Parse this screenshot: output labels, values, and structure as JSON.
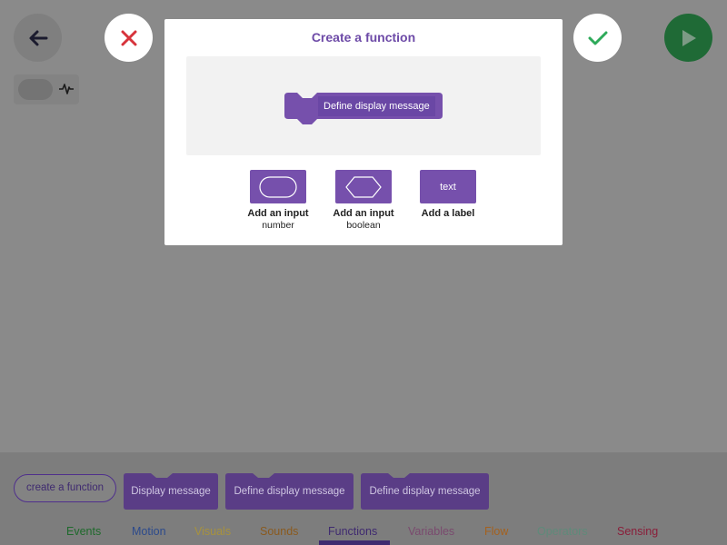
{
  "modal": {
    "title": "Create a function",
    "preview_block_label": "Define display message",
    "options": [
      {
        "title": "Add an input",
        "subtitle": "number"
      },
      {
        "title": "Add an input",
        "subtitle": "boolean"
      },
      {
        "title": "Add a label",
        "subtitle": "",
        "tile_text": "text"
      }
    ]
  },
  "toolbar": {
    "back_icon": "arrow-left-icon",
    "cancel_icon": "close-icon",
    "confirm_icon": "check-icon",
    "play_icon": "play-icon",
    "pulse_icon": "pulse-icon"
  },
  "palette": {
    "create_button_label": "create a function",
    "blocks": [
      {
        "label": "Display message"
      },
      {
        "label": "Define display message"
      },
      {
        "label": "Define display message"
      }
    ]
  },
  "tabs": [
    {
      "label": "Events",
      "color": "#1f6a2c"
    },
    {
      "label": "Motion",
      "color": "#2c4a8c"
    },
    {
      "label": "Visuals",
      "color": "#a7923e"
    },
    {
      "label": "Sounds",
      "color": "#8a5a1e"
    },
    {
      "label": "Functions",
      "color": "#3f2a70",
      "selected": true
    },
    {
      "label": "Variables",
      "color": "#7a4a6e"
    },
    {
      "label": "Flow",
      "color": "#a4611e"
    },
    {
      "label": "Operators",
      "color": "#5f8a7a"
    },
    {
      "label": "Sensing",
      "color": "#8a1e3a"
    }
  ],
  "colors": {
    "accent": "#6d4aa7",
    "block": "#7650ac",
    "confirm_green": "#2eaa5a",
    "cancel_red": "#d7333b"
  }
}
